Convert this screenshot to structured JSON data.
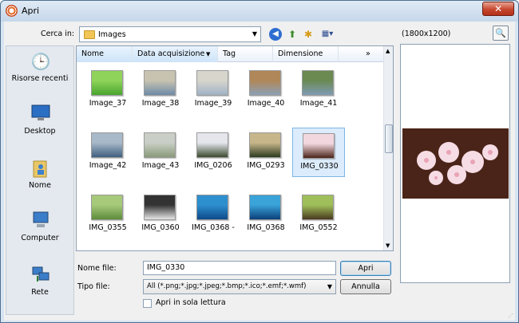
{
  "window": {
    "title": "Apri",
    "close_label": "✕"
  },
  "toolbar": {
    "look_in_label": "Cerca in:",
    "look_in_value": "Images",
    "back_icon": "back-arrow-icon",
    "up_icon": "up-folder-icon",
    "new_folder_icon": "new-folder-icon",
    "views_icon": "views-menu-icon"
  },
  "places": [
    {
      "label": "Risorse recenti",
      "icon": "recent-places-icon"
    },
    {
      "label": "Desktop",
      "icon": "desktop-icon"
    },
    {
      "label": "Nome",
      "icon": "user-folder-icon"
    },
    {
      "label": "Computer",
      "icon": "computer-icon"
    },
    {
      "label": "Rete",
      "icon": "network-icon"
    }
  ],
  "columns": {
    "name": "Nome",
    "date": "Data acquisizione",
    "tag": "Tag",
    "size": "Dimensione",
    "more": "»"
  },
  "files": [
    {
      "name": "Image_37",
      "color1": "#4aa52e",
      "color2": "#8fd35a"
    },
    {
      "name": "Image_38",
      "color1": "#6e8aa8",
      "color2": "#c8c3b0"
    },
    {
      "name": "Image_39",
      "color1": "#9fb2c6",
      "color2": "#d7d5cc"
    },
    {
      "name": "Image_40",
      "color1": "#8aa0b6",
      "color2": "#b08758"
    },
    {
      "name": "Image_41",
      "color1": "#7f9bb5",
      "color2": "#6a8a52"
    },
    {
      "name": "Image_42",
      "color1": "#3f5f80",
      "color2": "#a8b9c9"
    },
    {
      "name": "Image_43",
      "color1": "#8a9a7a",
      "color2": "#c9cfc6"
    },
    {
      "name": "IMG_0206",
      "color1": "#3b4a2e",
      "color2": "#e4e6ec"
    },
    {
      "name": "IMG_0293",
      "color1": "#2c3b20",
      "color2": "#c7b68a"
    },
    {
      "name": "IMG_0330",
      "color1": "#4a2418",
      "color2": "#f2d7de",
      "selected": true
    },
    {
      "name": "IMG_0355",
      "color1": "#5d8c3a",
      "color2": "#a6c97a"
    },
    {
      "name": "IMG_0360",
      "color1": "#e6e6e6",
      "color2": "#333333"
    },
    {
      "name": "IMG_0368 -",
      "color1": "#0d4a8a",
      "color2": "#2e8fcf"
    },
    {
      "name": "IMG_0368",
      "color1": "#0b3f7a",
      "color2": "#3aa3d8"
    },
    {
      "name": "IMG_0552",
      "color1": "#4a3a1e",
      "color2": "#9fbf5a"
    }
  ],
  "form": {
    "filename_label": "Nome file:",
    "filename_value": "IMG_0330",
    "open_label": "Apri",
    "filetype_label": "Tipo file:",
    "filetype_value": "All (*.png;*.jpg;*.jpeg;*.bmp;*.ico;*.emf;*.wmf)",
    "cancel_label": "Annulla",
    "readonly_label": "Apri in sola lettura"
  },
  "preview": {
    "size_text": "(1800x1200)"
  }
}
